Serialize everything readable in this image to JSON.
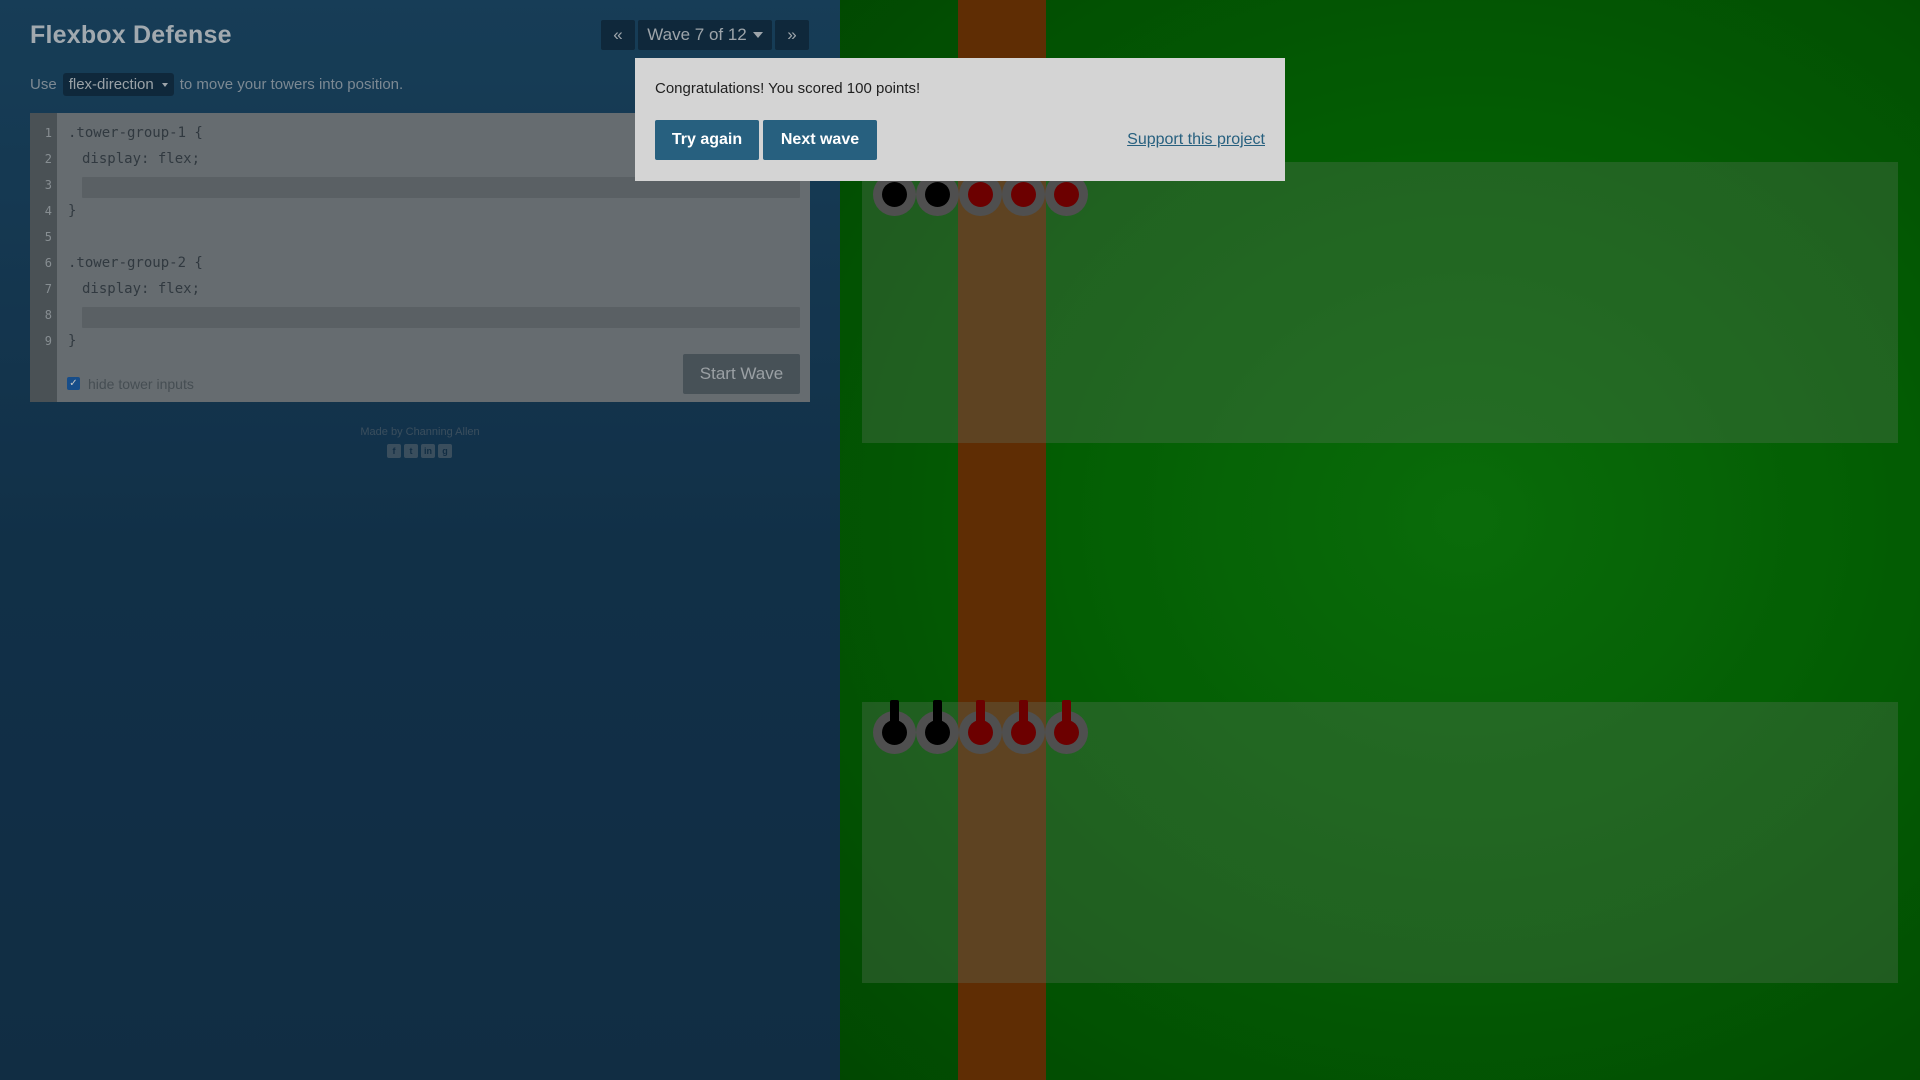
{
  "app": {
    "title": "Flexbox Defense"
  },
  "wave_nav": {
    "prev_icon": "«",
    "current": "Wave 7 of 12",
    "next_icon": "»"
  },
  "instructions": {
    "prefix": "Use",
    "property": "flex-direction",
    "suffix": "to move your towers into position."
  },
  "editor": {
    "line_numbers": [
      "1",
      "2",
      "3",
      "4",
      "5",
      "6",
      "7",
      "8",
      "9"
    ],
    "lines": [
      ".tower-group-1 {",
      "display: flex;",
      "",
      "}",
      "",
      ".tower-group-2 {",
      "display: flex;",
      "",
      "}"
    ],
    "input_values": [
      "",
      ""
    ],
    "hide_inputs_label": "hide tower inputs",
    "hide_inputs_checked": true,
    "start_button": "Start Wave"
  },
  "footer": {
    "credit": "Made by Channing Allen",
    "icons": [
      "facebook-icon",
      "twitter-icon",
      "linkedin-icon",
      "github-icon"
    ]
  },
  "battlefield": {
    "group_1_towers": [
      "black",
      "black",
      "red",
      "red",
      "red"
    ],
    "group_2_towers": [
      "black",
      "black",
      "red",
      "red",
      "red"
    ],
    "colors": {
      "grass": "#057905",
      "path": "#7a3a06",
      "tower_black": "#000000",
      "tower_red": "#8b0000"
    }
  },
  "modal": {
    "message": "Congratulations! You scored 100 points!",
    "try_again": "Try again",
    "next_wave": "Next wave",
    "support_link": "Support this project"
  },
  "colors": {
    "panel": "#1e4f70",
    "modal_button": "#27607f",
    "modal_bg": "#d4d4d4"
  }
}
